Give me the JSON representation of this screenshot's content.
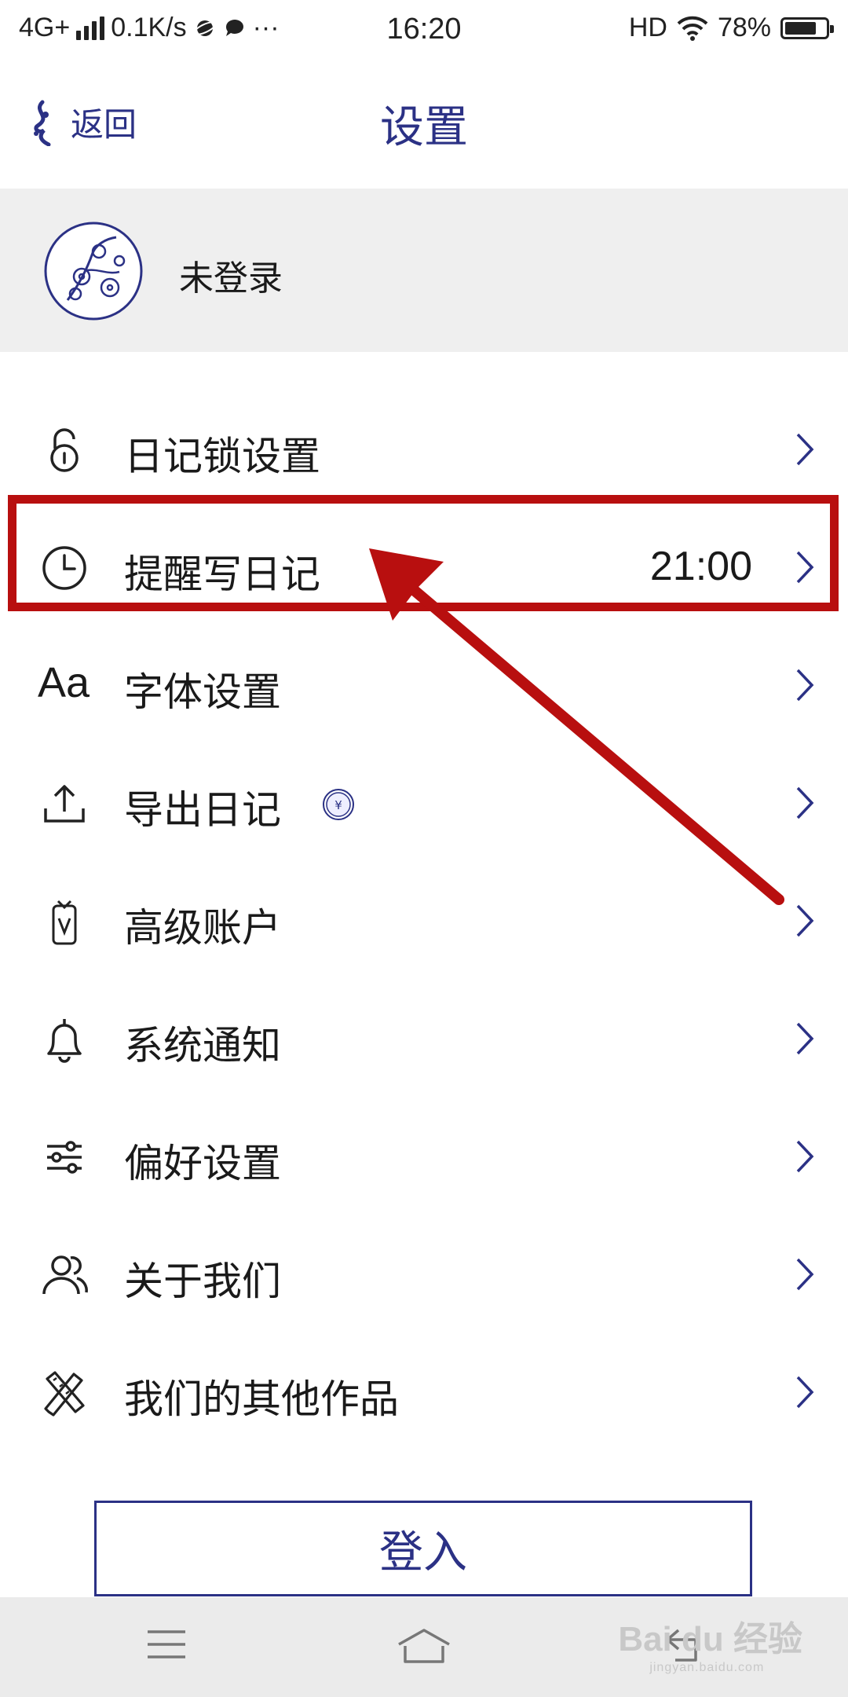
{
  "status_bar": {
    "network": "4G+",
    "speed": "0.1K/s",
    "more": "···",
    "time": "16:20",
    "hd": "HD",
    "battery": "78%",
    "battery_level": 0.78
  },
  "header": {
    "back_label": "返回",
    "title": "设置"
  },
  "profile": {
    "name": "未登录"
  },
  "menu": [
    {
      "label": "日记锁设置",
      "icon": "lock-icon"
    },
    {
      "label": "提醒写日记",
      "value": "21:00",
      "icon": "clock-icon"
    },
    {
      "label": "字体设置",
      "icon": "font-icon"
    },
    {
      "label": "导出日记",
      "icon": "export-icon",
      "badge": "¥"
    },
    {
      "label": "高级账户",
      "icon": "premium-tag-icon"
    },
    {
      "label": "系统通知",
      "icon": "bell-icon"
    },
    {
      "label": "偏好设置",
      "icon": "sliders-icon"
    },
    {
      "label": "关于我们",
      "icon": "users-icon"
    },
    {
      "label": "我们的其他作品",
      "icon": "pencil-ruler-icon"
    }
  ],
  "font_icon_text": "Aa",
  "login_label": "登入",
  "watermark": {
    "main": "Bai du 经验",
    "sub": "jingyan.baidu.com"
  },
  "colors": {
    "accent": "#2b3185",
    "annotation": "#b80f0f",
    "profile_bg": "#efefef",
    "nav_bg": "#ebebeb"
  }
}
